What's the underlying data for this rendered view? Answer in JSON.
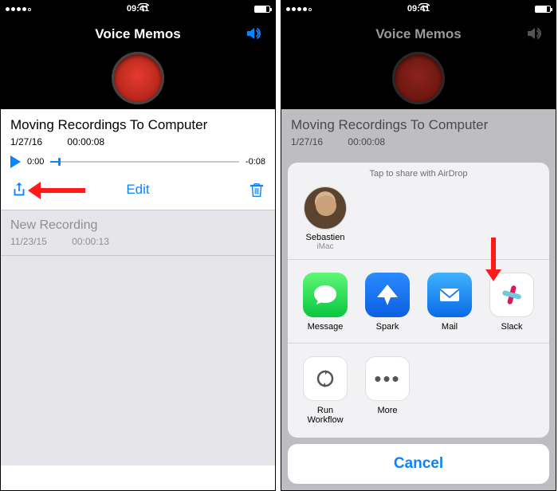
{
  "status": {
    "time": "09:41",
    "carrier_dots": 5,
    "wifi": "􀙇"
  },
  "header": {
    "title": "Voice Memos"
  },
  "selected": {
    "title": "Moving Recordings To Computer",
    "date": "1/27/16",
    "duration": "00:00:08",
    "elapsed": "0:00",
    "remaining": "-0:08",
    "edit_label": "Edit"
  },
  "list": [
    {
      "title": "New Recording",
      "date": "11/23/15",
      "duration": "00:00:13"
    }
  ],
  "share_sheet": {
    "airdrop_hint": "Tap to share with AirDrop",
    "contacts": [
      {
        "name": "Sebastien",
        "device": "iMac"
      }
    ],
    "apps": [
      {
        "id": "message",
        "label": "Message"
      },
      {
        "id": "spark",
        "label": "Spark"
      },
      {
        "id": "mail",
        "label": "Mail"
      },
      {
        "id": "slack",
        "label": "Slack"
      }
    ],
    "actions": [
      {
        "id": "run-workflow",
        "label": "Run\nWorkflow"
      },
      {
        "id": "more",
        "label": "More"
      }
    ],
    "cancel_label": "Cancel"
  }
}
